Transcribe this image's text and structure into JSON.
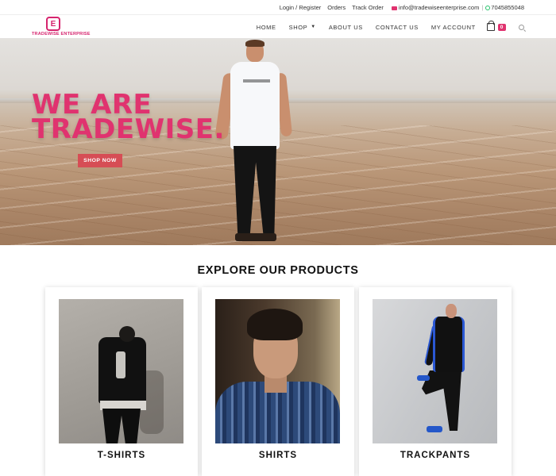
{
  "topbar": {
    "login": "Login / Register",
    "orders": "Orders",
    "track": "Track Order",
    "email": "info@tradewiseenterprise.com",
    "separator": "|",
    "phone": "7045855048"
  },
  "brand": {
    "mark": "E",
    "name": "TRADEWISE ENTERPRISE"
  },
  "nav": {
    "items": [
      "HOME",
      "SHOP",
      "ABOUT US",
      "CONTACT US",
      "MY ACCOUNT"
    ],
    "cart_count": "0"
  },
  "hero": {
    "line1": "WE ARE",
    "line2": "TRADEWISE.",
    "cta": "SHOP NOW"
  },
  "products": {
    "title": "EXPLORE OUR PRODUCTS",
    "cards": [
      {
        "label": "T-SHIRTS"
      },
      {
        "label": "SHIRTS"
      },
      {
        "label": "TRACKPANTS"
      }
    ]
  },
  "colors": {
    "accent": "#e0336f",
    "button": "#d64d55"
  }
}
